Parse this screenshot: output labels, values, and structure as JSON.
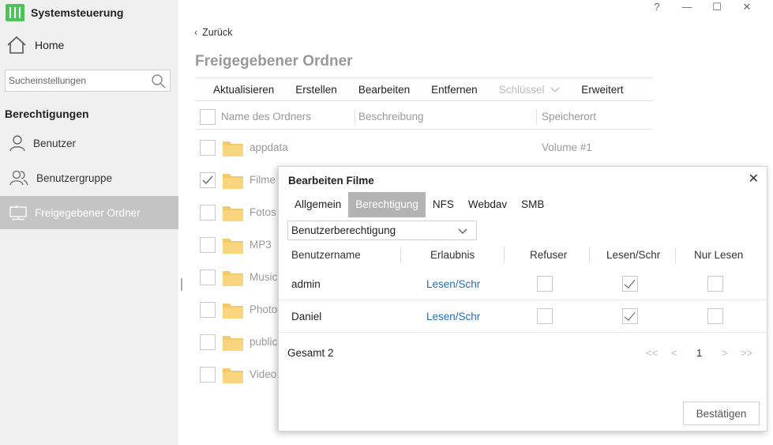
{
  "app": {
    "title": "Systemsteuerung"
  },
  "sidebar": {
    "home_label": "Home",
    "search_placeholder": "Sucheinstellungen",
    "section_title": "Berechtigungen",
    "items": [
      {
        "label": "Benutzer",
        "icon": "user-icon"
      },
      {
        "label": "Benutzergruppe",
        "icon": "user-group-icon"
      },
      {
        "label": "Freigegebener Ordner",
        "icon": "shared-folder-icon",
        "active": true
      }
    ]
  },
  "window_controls": {
    "help": "?",
    "minimize": "—",
    "maximize": "☐",
    "close": "✕"
  },
  "main": {
    "back_label": "Zurück",
    "title": "Freigegebener Ordner",
    "toolbar": {
      "refresh": "Aktualisieren",
      "create": "Erstellen",
      "edit": "Bearbeiten",
      "remove": "Entfernen",
      "key": "Schlüssel",
      "advanced": "Erweitert"
    },
    "columns": {
      "name": "Name des Ordners",
      "description": "Beschreibung",
      "location": "Speicherort"
    },
    "folders": [
      {
        "name": "appdata",
        "location": "Volume #1",
        "checked": false
      },
      {
        "name": "Filme",
        "location": "",
        "checked": true
      },
      {
        "name": "Fotos",
        "location": "",
        "checked": false
      },
      {
        "name": "MP3",
        "location": "",
        "checked": false
      },
      {
        "name": "Music",
        "location": "",
        "checked": false
      },
      {
        "name": "Photo",
        "location": "",
        "checked": false
      },
      {
        "name": "public",
        "location": "",
        "checked": false
      },
      {
        "name": "Video",
        "location": "",
        "checked": false
      }
    ]
  },
  "dialog": {
    "title": "Bearbeiten Filme",
    "close": "✕",
    "tabs": [
      "Allgemein",
      "Berechtigung",
      "NFS",
      "Webdav",
      "SMB"
    ],
    "active_tab": "Berechtigung",
    "permission_type": "Benutzerberechtigung",
    "columns": {
      "username": "Benutzername",
      "permission": "Erlaubnis",
      "deny": "Refuser",
      "read_write": "Lesen/Schr",
      "read_only": "Nur Lesen"
    },
    "rows": [
      {
        "user": "admin",
        "permission": "Lesen/Schr",
        "deny": false,
        "read_write": true,
        "read_only": false
      },
      {
        "user": "Daniel",
        "permission": "Lesen/Schr",
        "deny": false,
        "read_write": true,
        "read_only": false
      }
    ],
    "total_label": "Gesamt 2",
    "pager": {
      "first": "<<",
      "prev": "<",
      "page": "1",
      "next": ">",
      "last": ">>"
    },
    "confirm_label": "Bestätigen"
  },
  "colors": {
    "accent": "#4cc35b",
    "link": "#1f6fbf",
    "active_nav": "#c4c4c4",
    "active_tab": "#b3b3b3",
    "folder": "#f5c86a"
  }
}
